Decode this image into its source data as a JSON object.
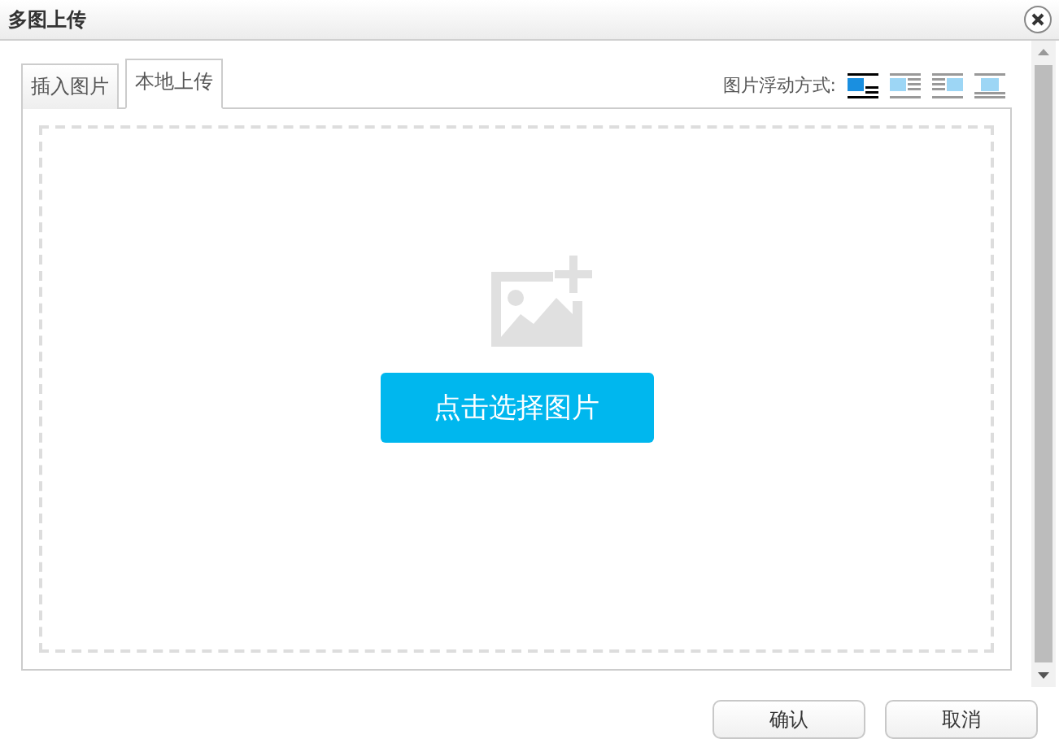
{
  "window": {
    "title": "多图上传"
  },
  "tabs": [
    {
      "label": "插入图片",
      "selected": false
    },
    {
      "label": "本地上传",
      "selected": true
    }
  ],
  "float": {
    "label": "图片浮动方式:",
    "options": [
      {
        "kind": "none",
        "selected": true
      },
      {
        "kind": "left",
        "selected": false
      },
      {
        "kind": "right",
        "selected": false
      },
      {
        "kind": "center",
        "selected": false
      }
    ]
  },
  "upload": {
    "button": "点击选择图片"
  },
  "buttons": [
    "确认",
    "取消"
  ]
}
